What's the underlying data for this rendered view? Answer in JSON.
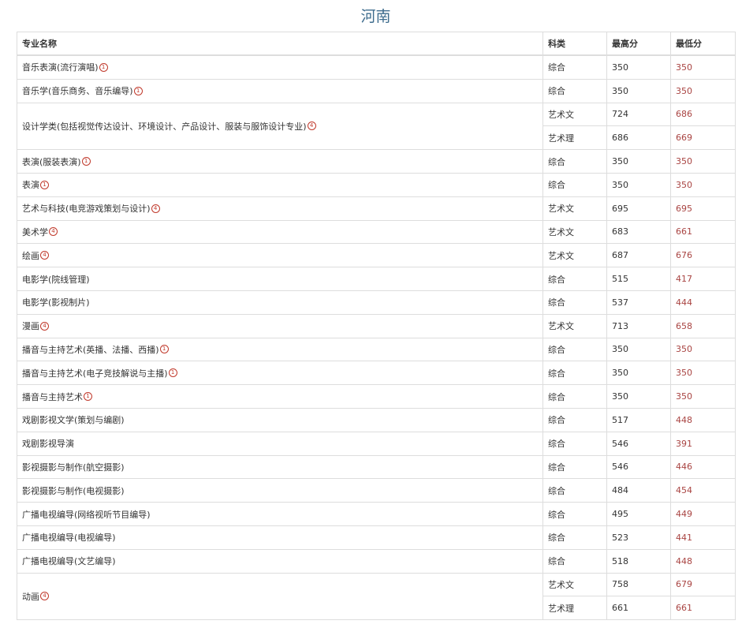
{
  "title": "河南",
  "headers": {
    "major": "专业名称",
    "category": "科类",
    "max": "最高分",
    "min": "最低分"
  },
  "rows": [
    {
      "major": "音乐表演(流行演唱)",
      "mark": "1",
      "category": "综合",
      "max": "350",
      "min": "350"
    },
    {
      "major": "音乐学(音乐商务、音乐编导)",
      "mark": "1",
      "category": "综合",
      "max": "350",
      "min": "350"
    },
    {
      "major": "设计学类(包括视觉传达设计、环境设计、产品设计、服装与服饰设计专业)",
      "mark": "4",
      "category": "艺术文",
      "max": "724",
      "min": "686"
    },
    {
      "major": "",
      "mark": "",
      "category": "艺术理",
      "max": "686",
      "min": "669"
    },
    {
      "major": "表演(服装表演)",
      "mark": "1",
      "category": "综合",
      "max": "350",
      "min": "350"
    },
    {
      "major": "表演",
      "mark": "1",
      "category": "综合",
      "max": "350",
      "min": "350"
    },
    {
      "major": "艺术与科技(电竞游戏策划与设计)",
      "mark": "4",
      "category": "艺术文",
      "max": "695",
      "min": "695"
    },
    {
      "major": "美术学",
      "mark": "4",
      "category": "艺术文",
      "max": "683",
      "min": "661"
    },
    {
      "major": "绘画",
      "mark": "4",
      "category": "艺术文",
      "max": "687",
      "min": "676"
    },
    {
      "major": "电影学(院线管理)",
      "mark": "",
      "category": "综合",
      "max": "515",
      "min": "417"
    },
    {
      "major": "电影学(影视制片)",
      "mark": "",
      "category": "综合",
      "max": "537",
      "min": "444"
    },
    {
      "major": "漫画",
      "mark": "4",
      "category": "艺术文",
      "max": "713",
      "min": "658"
    },
    {
      "major": "播音与主持艺术(英播、法播、西播)",
      "mark": "1",
      "category": "综合",
      "max": "350",
      "min": "350"
    },
    {
      "major": "播音与主持艺术(电子竞技解说与主播)",
      "mark": "1",
      "category": "综合",
      "max": "350",
      "min": "350"
    },
    {
      "major": "播音与主持艺术",
      "mark": "1",
      "category": "综合",
      "max": "350",
      "min": "350"
    },
    {
      "major": "戏剧影视文学(策划与编剧)",
      "mark": "",
      "category": "综合",
      "max": "517",
      "min": "448"
    },
    {
      "major": "戏剧影视导演",
      "mark": "",
      "category": "综合",
      "max": "546",
      "min": "391"
    },
    {
      "major": "影视摄影与制作(航空摄影)",
      "mark": "",
      "category": "综合",
      "max": "546",
      "min": "446"
    },
    {
      "major": "影视摄影与制作(电视摄影)",
      "mark": "",
      "category": "综合",
      "max": "484",
      "min": "454"
    },
    {
      "major": "广播电视编导(网络视听节目编导)",
      "mark": "",
      "category": "综合",
      "max": "495",
      "min": "449"
    },
    {
      "major": "广播电视编导(电视编导)",
      "mark": "",
      "category": "综合",
      "max": "523",
      "min": "441"
    },
    {
      "major": "广播电视编导(文艺编导)",
      "mark": "",
      "category": "综合",
      "max": "518",
      "min": "448"
    },
    {
      "major": "动画",
      "mark": "4",
      "category": "艺术文",
      "max": "758",
      "min": "679"
    },
    {
      "major": "",
      "mark": "",
      "category": "艺术理",
      "max": "661",
      "min": "661"
    }
  ]
}
